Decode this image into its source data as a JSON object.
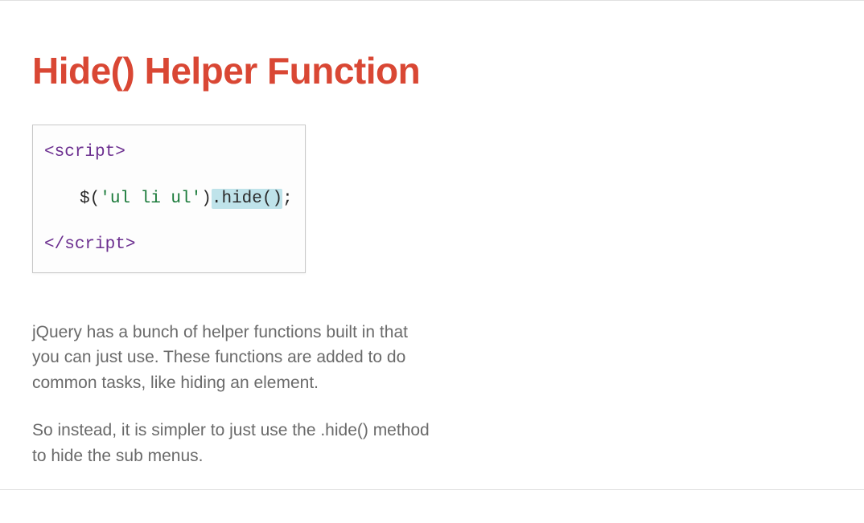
{
  "slide": {
    "title": "Hide() Helper Function",
    "code": {
      "open_tag_lt": "<",
      "open_tag_name": "script",
      "open_tag_gt": ">",
      "jq_dollar": "$",
      "jq_open_paren": "(",
      "jq_selector": "'ul li ul'",
      "jq_close_paren": ")",
      "jq_method": ".hide()",
      "jq_semi": ";",
      "close_tag_lt": "<",
      "close_tag_slash": "/",
      "close_tag_name": "script",
      "close_tag_gt": ">"
    },
    "paragraph1": "jQuery has a bunch of helper functions built in that you can just use. These functions are added to do common tasks, like hiding an element.",
    "paragraph2": "So instead, it is simpler to just use the .hide() method to hide the sub menus."
  }
}
